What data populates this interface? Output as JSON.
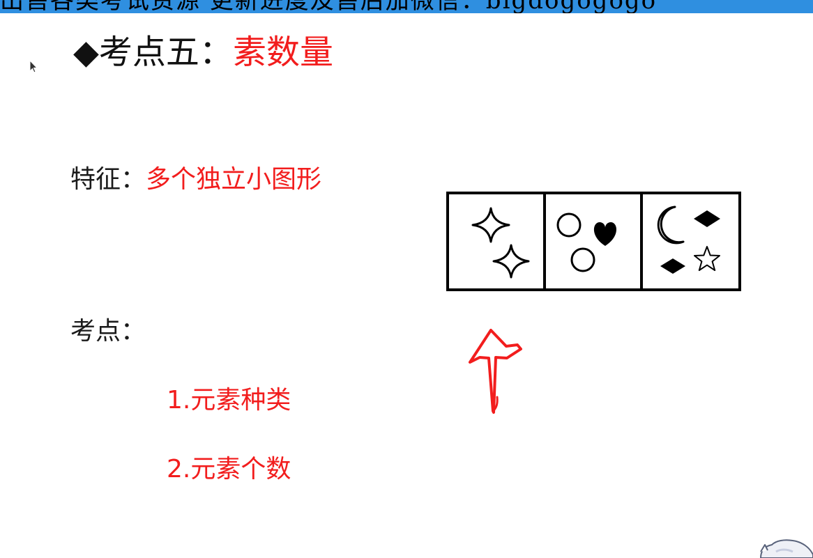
{
  "banner": {
    "text": "出售各类考试资源 更新进度及售后加微信：bigdogogogo"
  },
  "title": {
    "bullet": "◆",
    "prefix": "考点五：",
    "highlight": "素数量"
  },
  "feature": {
    "label": "特征：",
    "value": "多个独立小图形"
  },
  "points": {
    "label": "考点：",
    "items": [
      "1.元素种类",
      "2.元素个数"
    ]
  },
  "figure": {
    "panels": [
      {
        "icons": [
          "four-point-star-icon",
          "four-point-star-icon"
        ]
      },
      {
        "icons": [
          "circle-icon",
          "heart-icon",
          "circle-icon"
        ]
      },
      {
        "icons": [
          "crescent-moon-icon",
          "diamond-icon",
          "diamond-icon",
          "star-outline-icon"
        ]
      }
    ]
  },
  "colors": {
    "accent": "#f21d1d",
    "banner": "#2f8fe0",
    "text": "#1a1a1a"
  }
}
